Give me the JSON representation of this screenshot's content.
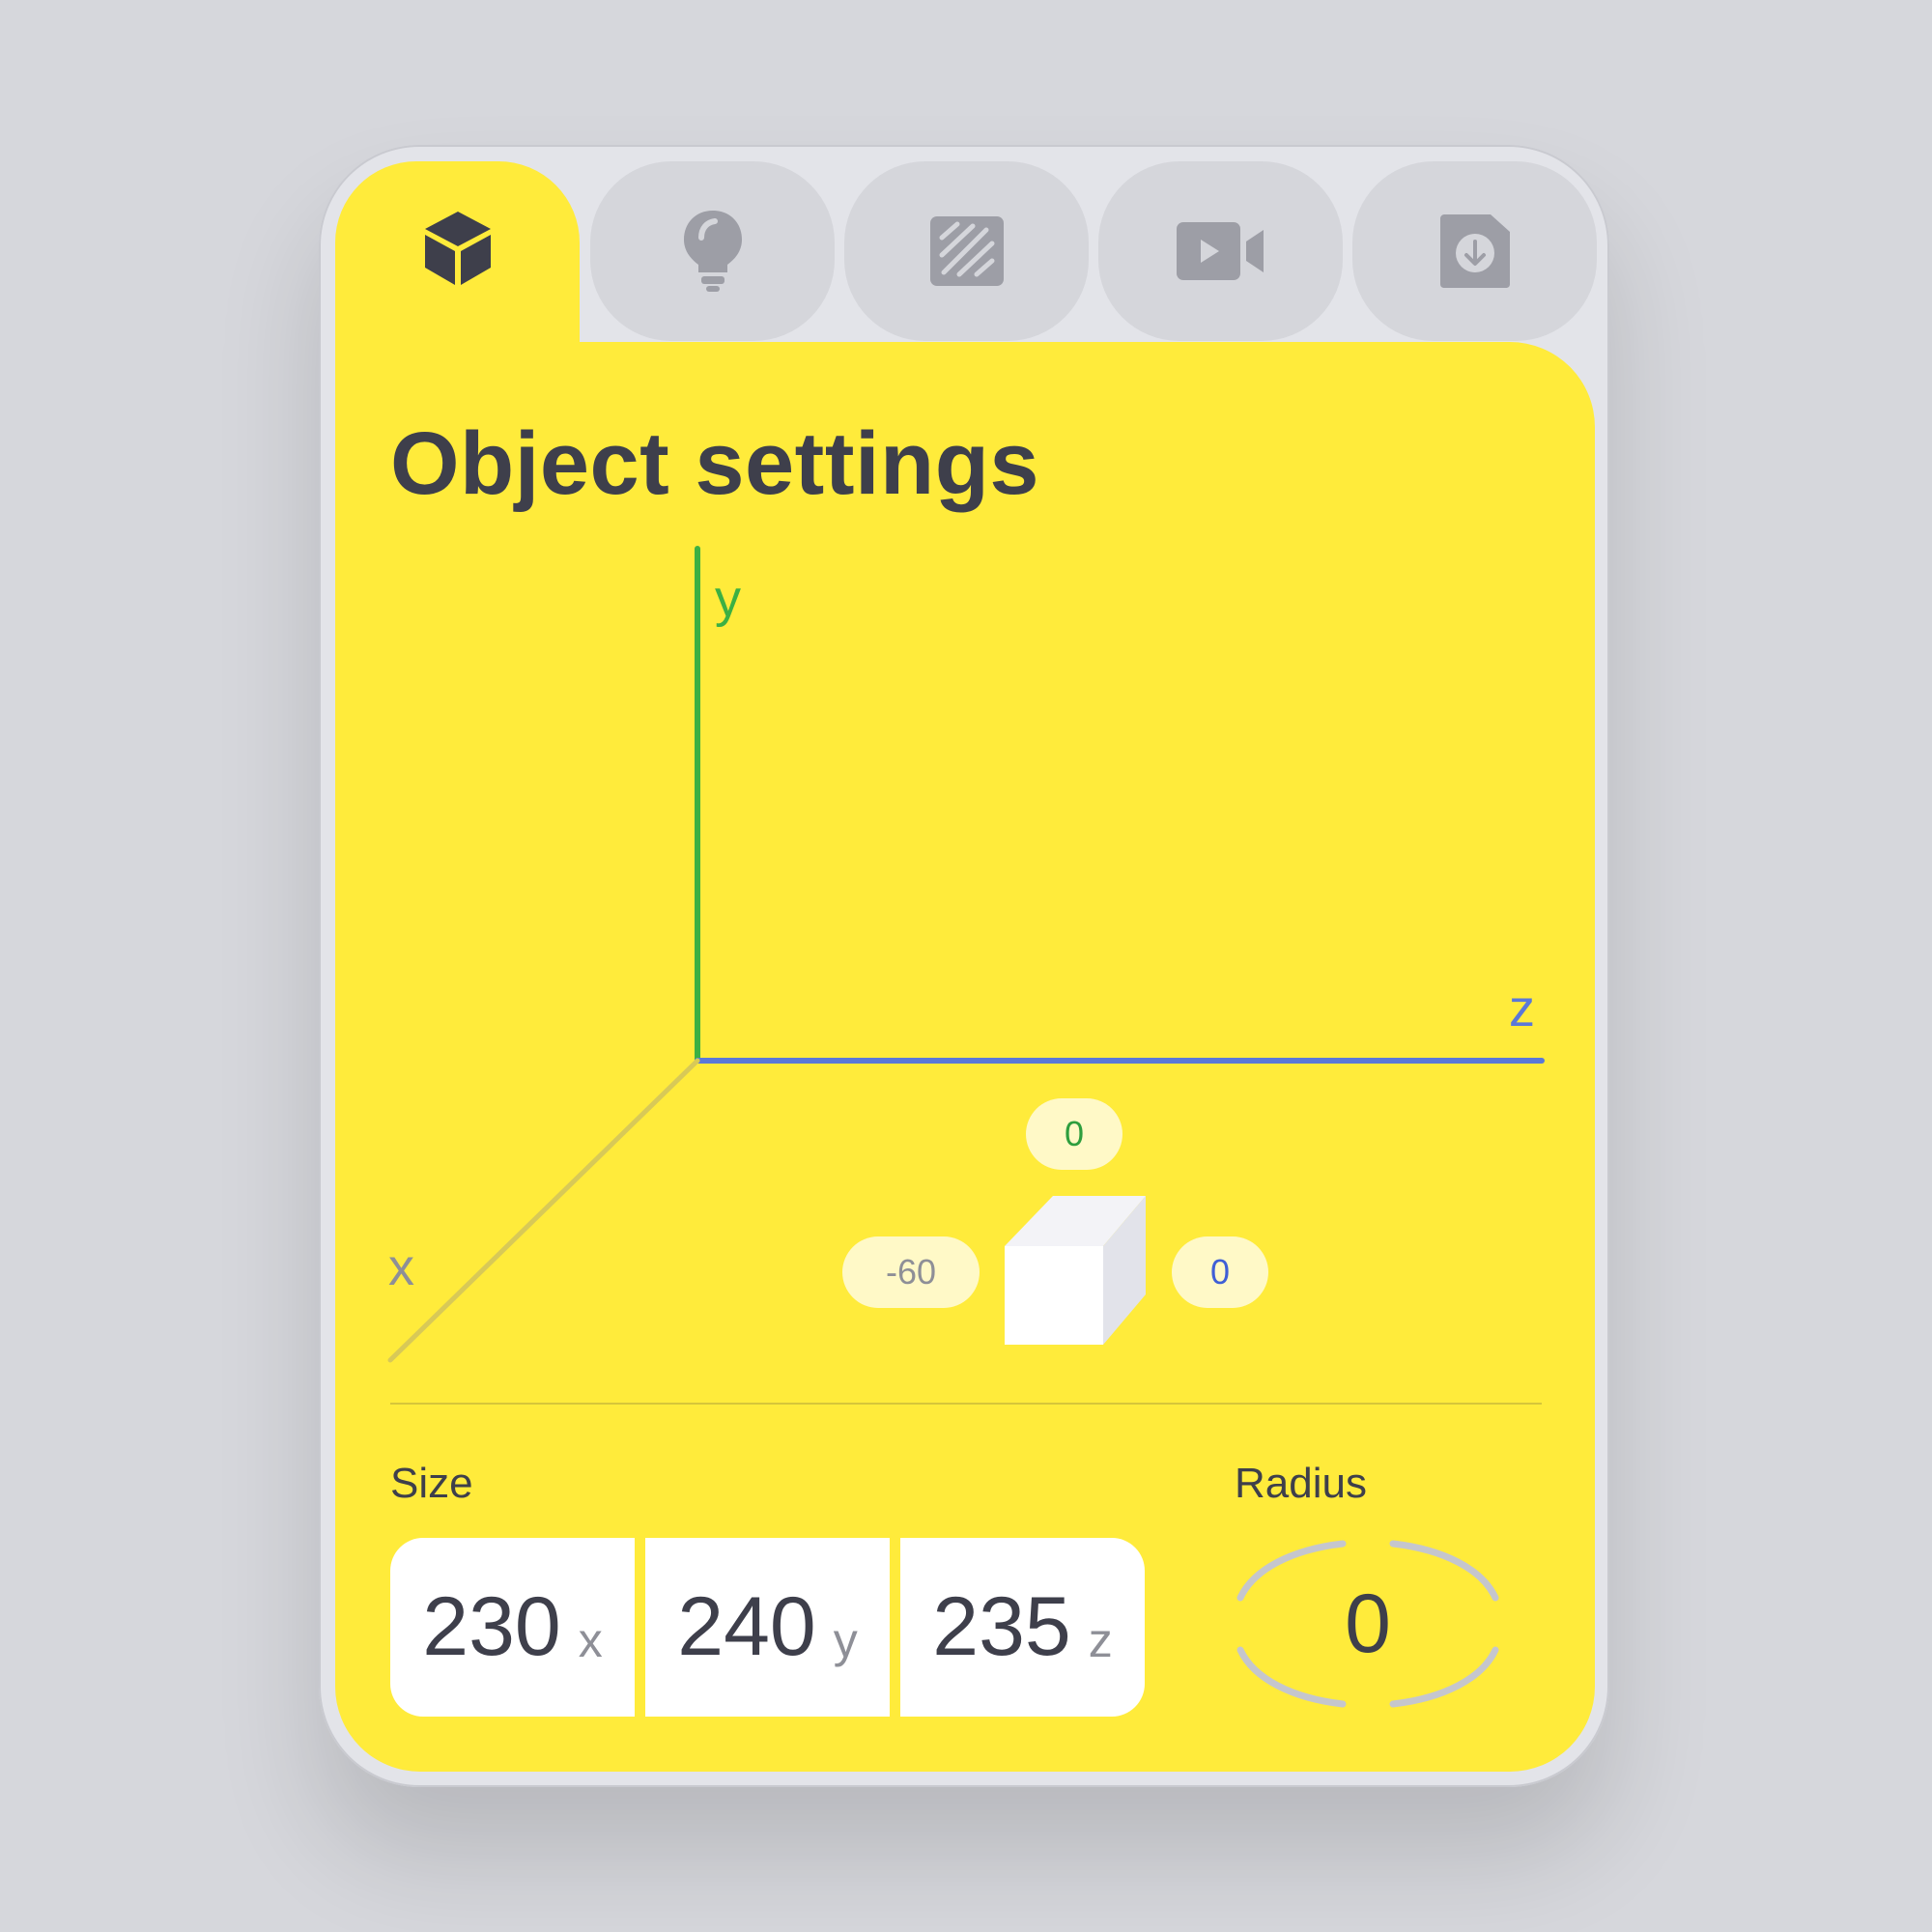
{
  "panel": {
    "title": "Object settings"
  },
  "tabs": [
    {
      "id": "object",
      "icon": "cube-icon",
      "active": true
    },
    {
      "id": "light",
      "icon": "lightbulb-icon",
      "active": false
    },
    {
      "id": "material",
      "icon": "texture-icon",
      "active": false
    },
    {
      "id": "camera",
      "icon": "video-camera-icon",
      "active": false
    },
    {
      "id": "export",
      "icon": "file-download-icon",
      "active": false
    }
  ],
  "axes": {
    "x_label": "x",
    "y_label": "y",
    "z_label": "z",
    "x_color": "#9a9a8a",
    "y_color": "#3cb043",
    "z_color": "#5b78d8"
  },
  "rotation": {
    "x": "-60",
    "y": "0",
    "z": "0"
  },
  "size": {
    "label": "Size",
    "x": {
      "value": "230",
      "unit": "x"
    },
    "y": {
      "value": "240",
      "unit": "y"
    },
    "z": {
      "value": "235",
      "unit": "z"
    }
  },
  "radius": {
    "label": "Radius",
    "value": "0"
  },
  "colors": {
    "accent": "#ffeb3b",
    "text": "#3e3f4b",
    "icon_inactive": "#9d9ea6"
  }
}
